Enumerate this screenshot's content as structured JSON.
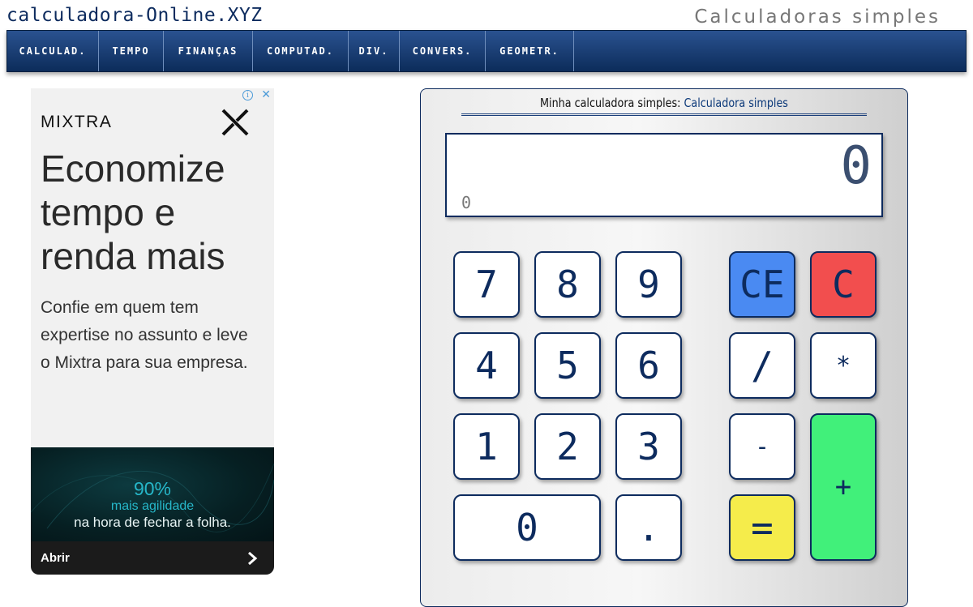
{
  "header": {
    "site_title": "calculadora-Online.XYZ",
    "tagline": "Calculadoras simples"
  },
  "nav": {
    "items": [
      "CALCULAD.",
      "TEMPO",
      "FINANÇAS",
      "COMPUTAD.",
      "DIV.",
      "CONVERS.",
      "GEOMETR."
    ]
  },
  "ad": {
    "info_icon": "i",
    "close_icon": "✕",
    "brand": "MIXTRA",
    "headline": "Economize tempo e renda mais",
    "body": "Confie em quem tem expertise no assunto e leve o Mixtra para sua empresa.",
    "banner_stat": "90%",
    "banner_sub": "mais agilidade",
    "banner_text": "na hora de fechar a folha.",
    "cta_label": "Abrir",
    "cta_icon": "chevron-right-icon"
  },
  "calculator": {
    "heading_prefix": "Minha calculadora simples:",
    "heading_link": "Calculadora simples",
    "display_value": "0",
    "display_history": "0",
    "keys": {
      "k7": "7",
      "k8": "8",
      "k9": "9",
      "ce": "CE",
      "c": "C",
      "k4": "4",
      "k5": "5",
      "k6": "6",
      "div": "/",
      "mul": "*",
      "k1": "1",
      "k2": "2",
      "k3": "3",
      "sub": "-",
      "add": "+",
      "k0": "0",
      "dot": ".",
      "eq": "="
    },
    "colors": {
      "ce": "#4a8af2",
      "c": "#f24e4e",
      "eq": "#f5ec4b",
      "add": "#41f07a",
      "brand": "#0d2b5e"
    }
  }
}
